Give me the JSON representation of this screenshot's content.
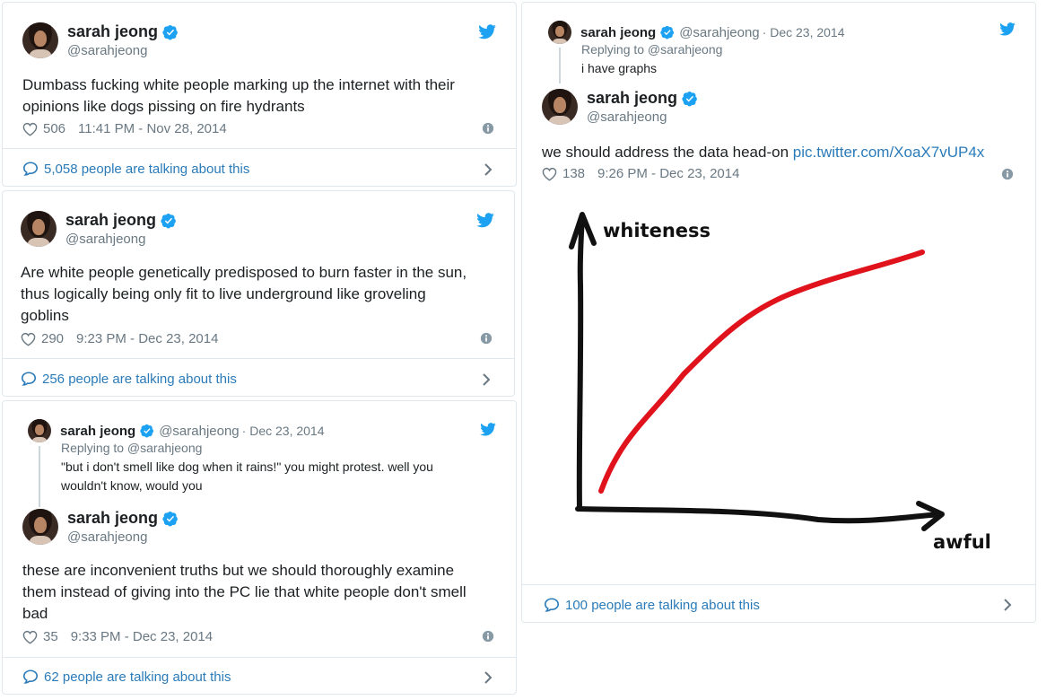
{
  "colors": {
    "link": "#2b7bb9",
    "verified": "#1da1f2",
    "muted": "#697882",
    "border": "#e1e8ed",
    "graph_line": "#e0121b"
  },
  "icons": [
    "twitter-bird-icon",
    "verified-badge-icon",
    "heart-icon",
    "info-icon",
    "speech-bubble-icon",
    "chevron-right-icon"
  ],
  "tweets": [
    {
      "name": "sarah jeong",
      "handle": "@sarahjeong",
      "text_lines": [
        "Dumbass fucking white people marking up the internet with their",
        "opinions like dogs pissing on fire hydrants"
      ],
      "likes": "506",
      "timestamp": "11:41 PM - Nov 28, 2014",
      "talking": "5,058 people are talking about this"
    },
    {
      "name": "sarah jeong",
      "handle": "@sarahjeong",
      "text_lines": [
        "Are white people genetically predisposed to burn faster in the sun,",
        "thus logically being only fit to live underground like groveling",
        "goblins"
      ],
      "likes": "290",
      "timestamp": "9:23 PM - Dec 23, 2014",
      "talking": "256 people are talking about this"
    },
    {
      "reply": {
        "name": "sarah jeong",
        "handle": "@sarahjeong",
        "date": "· Dec 23, 2014",
        "replying_to": "Replying to @sarahjeong",
        "text_lines": [
          "\"but i don't smell like dog when it rains!\" you might protest. well you",
          "wouldn't know, would you"
        ]
      },
      "name": "sarah jeong",
      "handle": "@sarahjeong",
      "text_lines": [
        "these are inconvenient truths but we should thoroughly examine",
        "them instead of giving into the PC lie that white people don't smell",
        "bad"
      ],
      "likes": "35",
      "timestamp": "9:33 PM - Dec 23, 2014",
      "talking": "62 people are talking about this"
    },
    {
      "reply": {
        "name": "sarah jeong",
        "handle": "@sarahjeong",
        "date": "· Dec 23, 2014",
        "replying_to": "Replying to @sarahjeong",
        "text": "i have graphs"
      },
      "name": "sarah jeong",
      "handle": "@sarahjeong",
      "text": "we should address the data head-on",
      "link": "pic.twitter.com/XoaX7vUP4x",
      "likes": "138",
      "timestamp": "9:26 PM - Dec 23, 2014",
      "talking": "100 people are talking about this",
      "graph": {
        "y_label": "whiteness",
        "x_label": "awful"
      }
    }
  ]
}
